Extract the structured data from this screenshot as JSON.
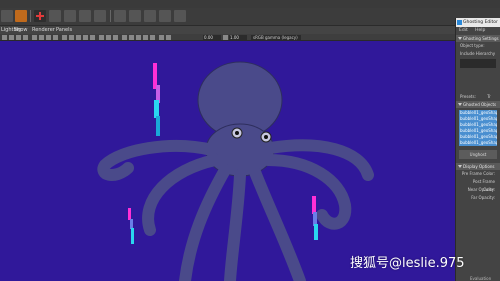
{
  "top_menu": {
    "left_items": [
      "Lighting",
      "Show",
      "Renderer",
      "Panels"
    ]
  },
  "viewbar": {
    "value1": "0.00",
    "value2": "1.00",
    "camera": "sRGB gamma (legacy)"
  },
  "panel": {
    "title": "Ghosting Editor",
    "menu": [
      "Edit",
      "Help"
    ],
    "sections": {
      "settings": "Ghosting Settings",
      "objects": "Ghosted Objects",
      "display": "Display Options"
    },
    "labels": {
      "object_type": "Object type:",
      "include_hierarchy": "Include Hierarchy",
      "presets": "Presets:",
      "presets_value": "Tr",
      "pre_frame_color": "Pre Frame Color:",
      "post_frame_color": "Post Frame Color:",
      "near_opacity": "Near Opacity:",
      "far_opacity": "Far Opacity:"
    },
    "objects": [
      "bubble01_geoShape",
      "bubble01_geoShape",
      "bubble01_geoShape",
      "bubble01_geoShape",
      "bubble01_geoShape",
      "bubble01_geoShape"
    ],
    "unghost_button": "Unghost"
  },
  "footer": {
    "evaluation": "Evaluation"
  },
  "watermark": "搜狐号@leslie.975",
  "colors": {
    "viewport_bg": "#30189a",
    "octopus": "#4a4a8a",
    "ghost_pink": "#ff2fd6",
    "ghost_cyan": "#2ad6f0",
    "accent": "#c06a1c"
  }
}
